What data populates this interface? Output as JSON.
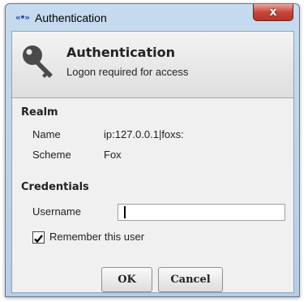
{
  "window": {
    "title": "Authentication",
    "close_label": "x"
  },
  "header": {
    "title": "Authentication",
    "subtitle": "Logon required for access",
    "icon": "key-icon"
  },
  "realm": {
    "section_label": "Realm",
    "name_label": "Name",
    "name_value": "ip:127.0.0.1|foxs:",
    "scheme_label": "Scheme",
    "scheme_value": "Fox"
  },
  "credentials": {
    "section_label": "Credentials",
    "username_label": "Username",
    "username_value": "",
    "remember_label": "Remember this user",
    "remember_checked": true
  },
  "buttons": {
    "ok_label": "OK",
    "cancel_label": "Cancel"
  },
  "colors": {
    "accent_close": "#c8463a",
    "title_icon": "#1c47b8",
    "window_frame": "#c6dbef"
  }
}
